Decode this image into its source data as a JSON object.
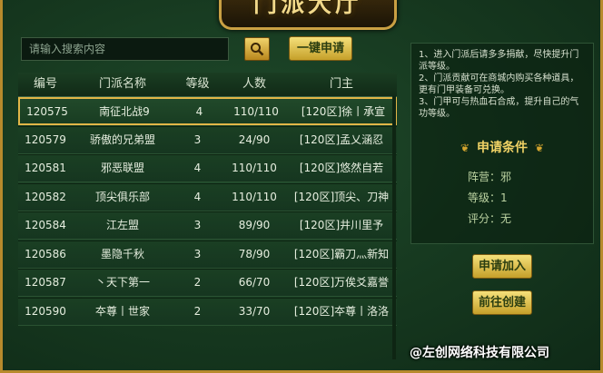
{
  "title": "门派大厅",
  "search": {
    "placeholder": "请输入搜索内容"
  },
  "apply_all_label": "一键申请",
  "table": {
    "headers": {
      "id": "编号",
      "name": "门派名称",
      "level": "等级",
      "members": "人数",
      "leader": "门主"
    },
    "rows": [
      {
        "id": "120575",
        "name": "南征北战9",
        "level": "4",
        "members": "110/110",
        "leader": "[120区]徐丨承宣"
      },
      {
        "id": "120579",
        "name": "骄傲的兄弟盟",
        "level": "3",
        "members": "24/90",
        "leader": "[120区]孟乂涵忍"
      },
      {
        "id": "120581",
        "name": "邪恶联盟",
        "level": "4",
        "members": "110/110",
        "leader": "[120区]悠然自若"
      },
      {
        "id": "120582",
        "name": "顶尖俱乐部",
        "level": "4",
        "members": "110/110",
        "leader": "[120区]顶尖、刀神"
      },
      {
        "id": "120584",
        "name": "江左盟",
        "level": "3",
        "members": "89/90",
        "leader": "[120区]井川里予"
      },
      {
        "id": "120586",
        "name": "墨隐千秋",
        "level": "3",
        "members": "78/90",
        "leader": "[120区]霸刀灬新知"
      },
      {
        "id": "120587",
        "name": "丶天下第一",
        "level": "2",
        "members": "66/70",
        "leader": "[120区]万俟爻嘉誉"
      },
      {
        "id": "120590",
        "name": "夲尊丨世家",
        "level": "2",
        "members": "33/70",
        "leader": "[120区]夲尊丨洛洛"
      }
    ]
  },
  "tips": [
    "1、进入门派后请多多捐献，尽快提升门派等级。",
    "2、门派贡献可在商城内购买各种道具，更有门甲装备可兑换。",
    "3、门甲可与热血石合成，提升自己的气功等级。"
  ],
  "conditions": {
    "title": "申请条件",
    "camp": "阵营：邪",
    "level": "等级：1",
    "score": "评分：无"
  },
  "apply_join_label": "申请加入",
  "goto_create_label": "前往创建",
  "watermark": "@左创网络科技有限公司"
}
